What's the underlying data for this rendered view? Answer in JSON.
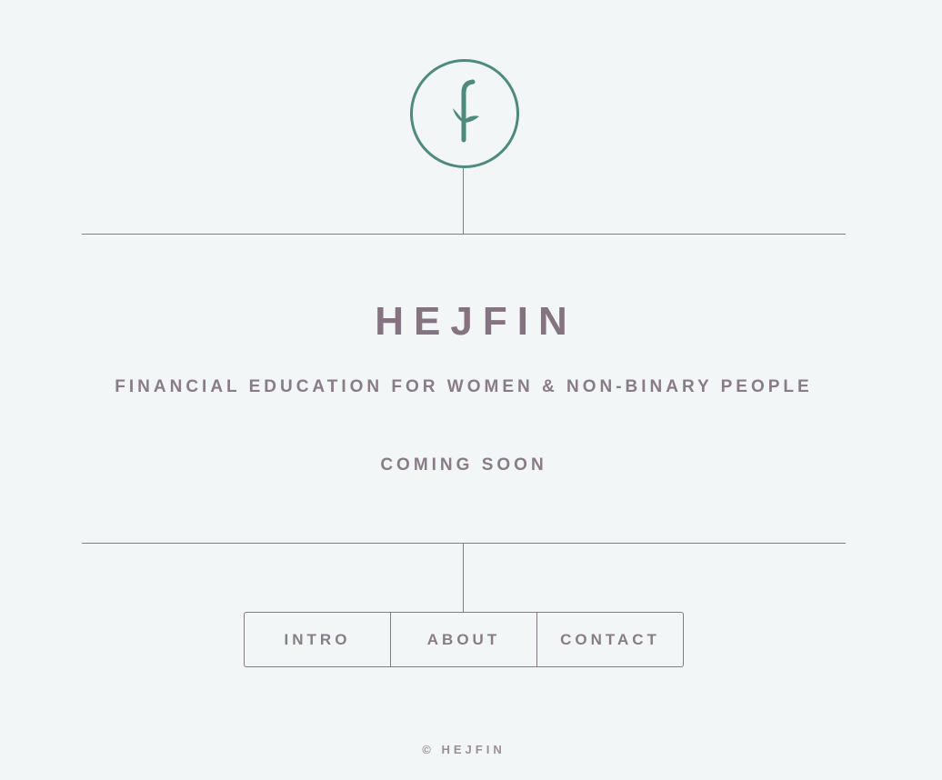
{
  "logo": {
    "icon": "bamboo-f-icon",
    "color": "#4e8a7e"
  },
  "brand": {
    "title": "HEJFIN",
    "tagline": "FINANCIAL EDUCATION FOR WOMEN & NON-BINARY PEOPLE",
    "status": "COMING SOON"
  },
  "nav": {
    "items": [
      {
        "label": "INTRO"
      },
      {
        "label": "ABOUT"
      },
      {
        "label": "CONTACT"
      }
    ]
  },
  "footer": {
    "copyright": "© HEJFIN"
  },
  "colors": {
    "background": "#f2f6f6",
    "text": "#857381",
    "accent": "#4e8a7e",
    "lines": "#877985"
  }
}
